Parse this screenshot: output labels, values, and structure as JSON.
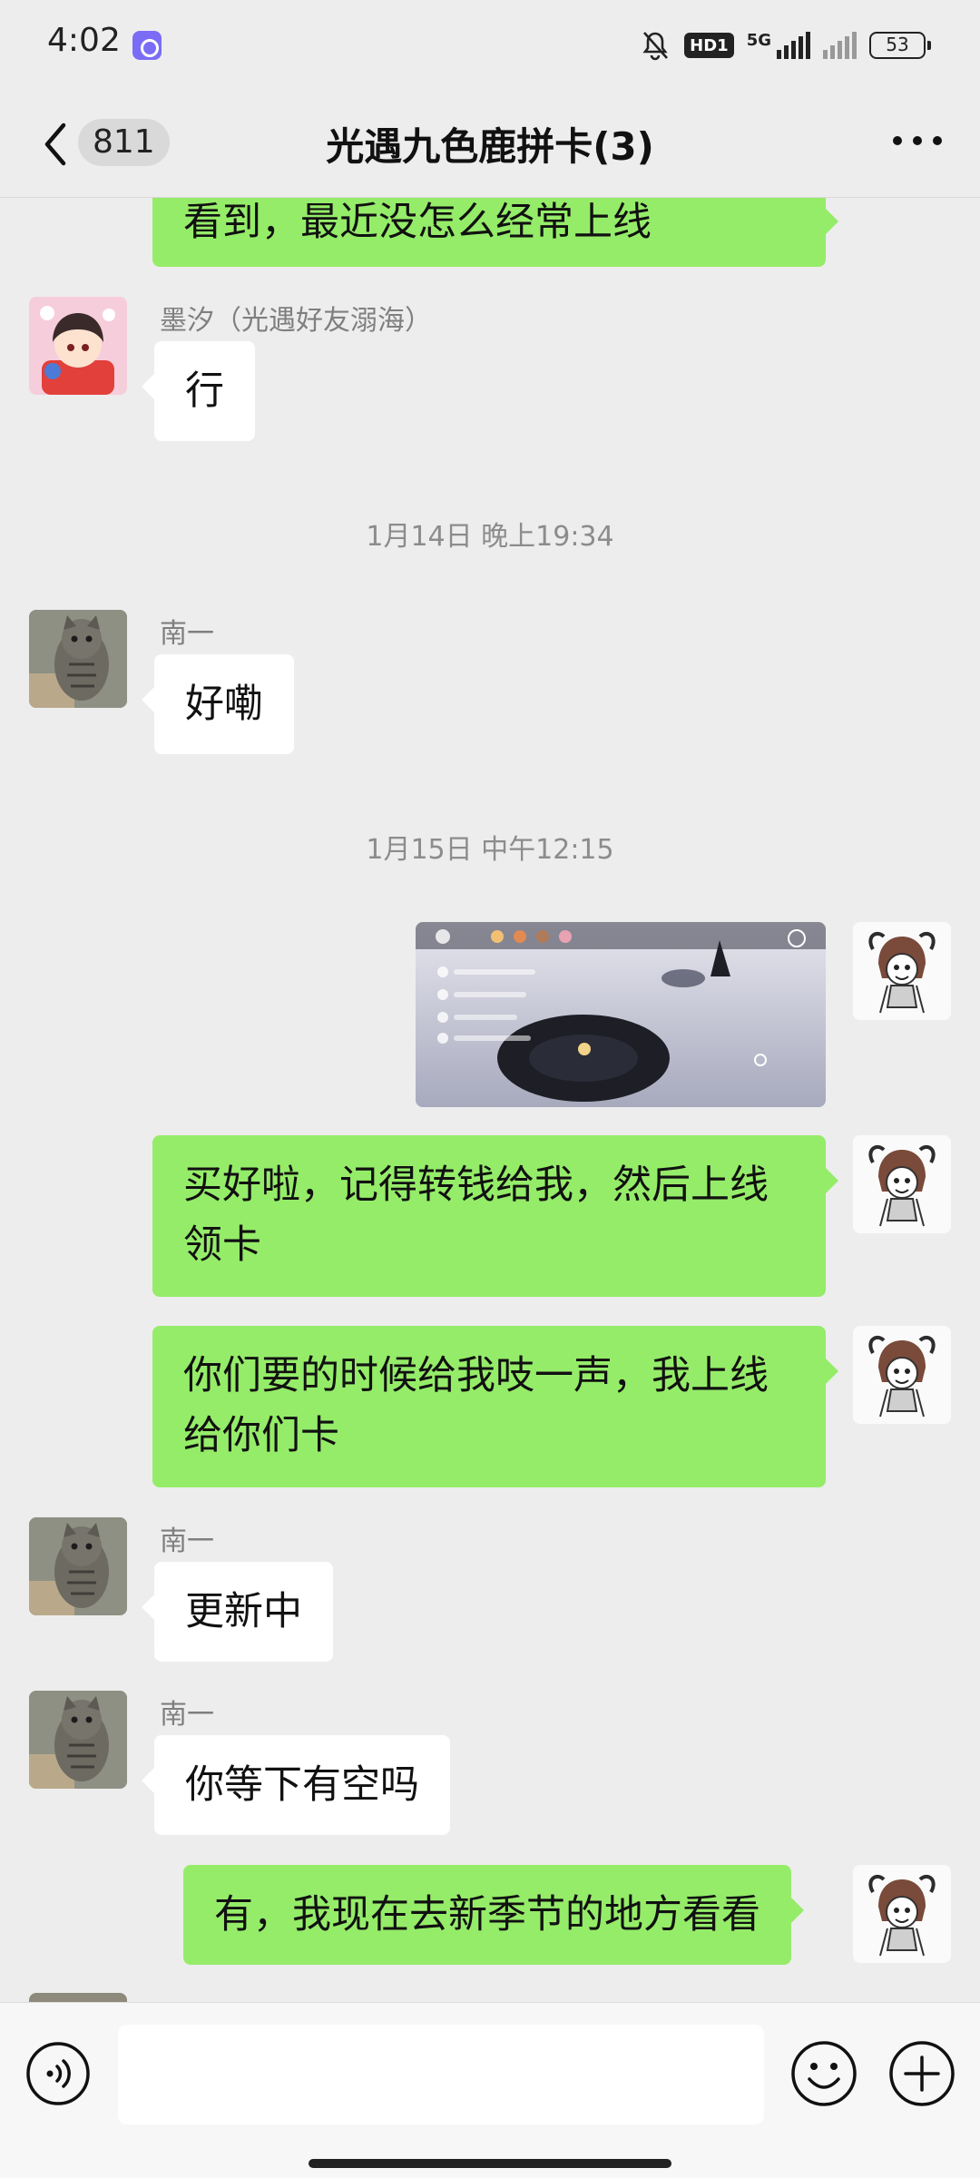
{
  "status_bar": {
    "time": "4:02",
    "hd_label": "HD1",
    "network_label": "5G",
    "battery": "53"
  },
  "header": {
    "unread_count": "811",
    "title": "光遇九色鹿拼卡(3)"
  },
  "messages": [
    {
      "type": "text",
      "direction": "out",
      "text": "看到，最近没怎么经常上线"
    },
    {
      "type": "text",
      "direction": "in",
      "sender": "墨汐（光遇好友溺海）",
      "avatar": "anime-girl-avatar",
      "text": "行"
    },
    {
      "type": "timestamp",
      "text": "1月14日 晚上19:34"
    },
    {
      "type": "text",
      "direction": "in",
      "sender": "南一",
      "avatar": "cat-avatar",
      "text": "好嘞"
    },
    {
      "type": "timestamp",
      "text": "1月15日 中午12:15"
    },
    {
      "type": "image",
      "direction": "out",
      "description_icon": "game-screenshot"
    },
    {
      "type": "text",
      "direction": "out",
      "text_lines": [
        "买好啦，记得转钱给我，然后上线",
        "领卡"
      ]
    },
    {
      "type": "text",
      "direction": "out",
      "text_lines": [
        "你们要的时候给我吱一声，我上线",
        "给你们卡"
      ]
    },
    {
      "type": "text",
      "direction": "in",
      "sender": "南一",
      "avatar": "cat-avatar",
      "text": "更新中"
    },
    {
      "type": "text",
      "direction": "in",
      "sender": "南一",
      "avatar": "cat-avatar",
      "text": "你等下有空吗"
    },
    {
      "type": "text",
      "direction": "out",
      "text": "有，我现在去新季节的地方看看"
    }
  ],
  "input_bar": {
    "text_value": ""
  },
  "colors": {
    "background": "#ededed",
    "outgoing_bubble": "#95ec69",
    "incoming_bubble": "#ffffff",
    "meta_text": "#8c8c8c"
  }
}
